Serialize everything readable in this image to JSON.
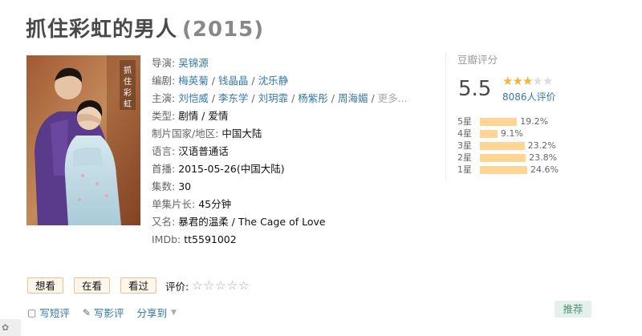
{
  "movie": {
    "title": "抓住彩虹的男人",
    "year": "(2015)",
    "poster_caption": "抓住彩虹的男人"
  },
  "info": {
    "director_label": "导演:",
    "directors": [
      "吴锦源"
    ],
    "writer_label": "编剧:",
    "writers": [
      "梅英菊",
      "钱晶晶",
      "沈乐静"
    ],
    "cast_label": "主演:",
    "cast": [
      "刘恺威",
      "李东学",
      "刘玥霏",
      "杨紫彤",
      "周海媚"
    ],
    "cast_more": "更多...",
    "genre_label": "类型:",
    "genres": "剧情 / 爱情",
    "country_label": "制片国家/地区:",
    "country": "中国大陆",
    "language_label": "语言:",
    "language": "汉语普通话",
    "premiere_label": "首播:",
    "premiere": "2015-05-26(中国大陆)",
    "episodes_label": "集数:",
    "episodes": "30",
    "runtime_label": "单集片长:",
    "runtime": "45分钟",
    "aka_label": "又名:",
    "aka": "暴君的温柔 / The Cage of Love",
    "imdb_label": "IMDb:",
    "imdb": "tt5591002"
  },
  "rating": {
    "title": "豆瓣评分",
    "score": "5.5",
    "stars_filled": 3,
    "stars_total": 5,
    "votes": "8086人评价",
    "distribution": [
      {
        "label": "5星",
        "percent": "19.2%",
        "value": 19.2
      },
      {
        "label": "4星",
        "percent": "9.1%",
        "value": 9.1
      },
      {
        "label": "3星",
        "percent": "23.2%",
        "value": 23.2
      },
      {
        "label": "2星",
        "percent": "23.8%",
        "value": 23.8
      },
      {
        "label": "1星",
        "percent": "24.6%",
        "value": 24.6
      }
    ]
  },
  "actions": {
    "want": "想看",
    "watching": "在看",
    "watched": "看过",
    "rate_label": "评价:"
  },
  "links": {
    "short_review": "写短评",
    "review": "写影评",
    "share": "分享到"
  },
  "recommend": "推荐",
  "colors": {
    "link": "#3377aa",
    "star": "#f4b33d",
    "bar": "#ffd596",
    "button_bg": "#fef6e9",
    "recommend_bg": "#e3f1ed"
  }
}
